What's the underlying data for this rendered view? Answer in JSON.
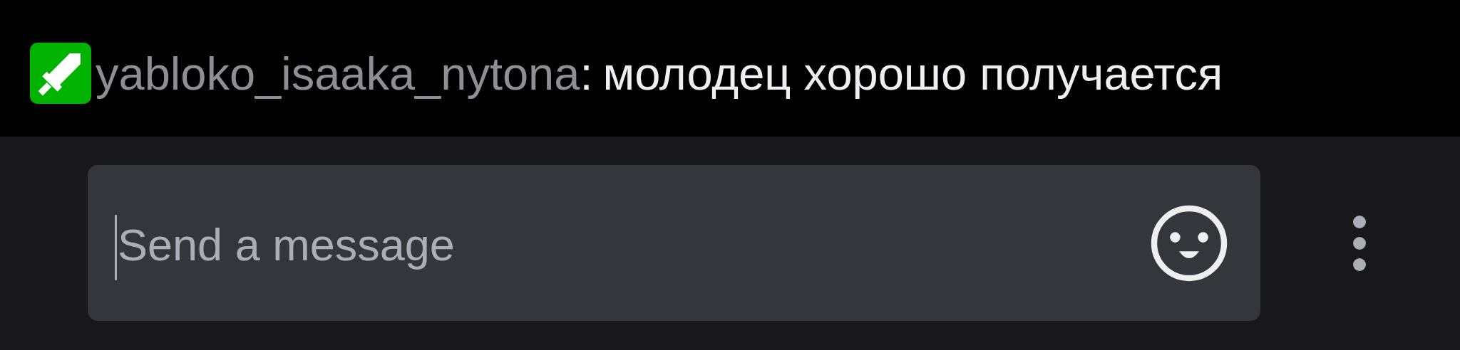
{
  "chat_message": {
    "username": "yabloko_isaaka_nytona",
    "separator": ":",
    "text": "молодец хорошо получается"
  },
  "chat_input": {
    "placeholder": "Send a message"
  }
}
